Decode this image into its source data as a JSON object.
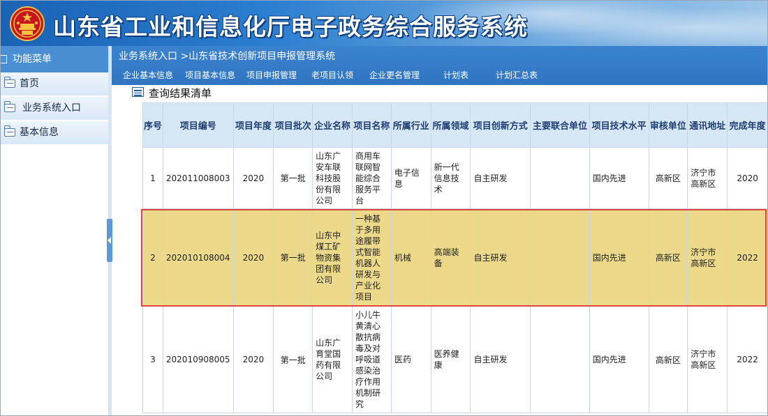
{
  "header": {
    "title": "山东省工业和信息化厅电子政务综合服务系统"
  },
  "sidebar": {
    "menu_title": "功能菜单",
    "items": [
      {
        "label": "首页"
      },
      {
        "label": "业务系统入口"
      },
      {
        "label": "基本信息"
      }
    ]
  },
  "main": {
    "breadcrumb": "业务系统入口 >山东省技术创新项目申报管理系统",
    "tabs": [
      {
        "label": "企业基本信息"
      },
      {
        "label": "项目基本信息"
      },
      {
        "label": "项目申报管理"
      },
      {
        "label": "老项目认领"
      },
      {
        "label": "企业更名管理"
      },
      {
        "label": "计划表"
      },
      {
        "label": "计划汇总表"
      }
    ],
    "result_title": "查询结果清单"
  },
  "table": {
    "columns": [
      "序号",
      "项目编号",
      "项目年度",
      "项目批次",
      "企业名称",
      "项目名称",
      "所属行业",
      "所属领域",
      "项目创新方式",
      "主要联合单位",
      "项目技术水平",
      "审核单位",
      "通讯地址",
      "完成年度"
    ],
    "rows": [
      {
        "seq": "1",
        "code": "202011008003",
        "year": "2020",
        "batch": "第一批",
        "company": "山东广安车联科技股份有限公司",
        "project": "商用车联网智能综合服务平台",
        "industry": "电子信息",
        "field": "新一代信息技术",
        "innovation": "自主研发",
        "partner": "",
        "level": "国内先进",
        "auditor": "高新区",
        "address": "济宁市高新区",
        "finish_year": "2020",
        "selected": false
      },
      {
        "seq": "2",
        "code": "202010108004",
        "year": "2020",
        "batch": "第一批",
        "company": "山东中煤工矿物资集团有限公司",
        "project": "一种基于多用途履带式智能机器人研发与产业化项目",
        "industry": "机械",
        "field": "高端装备",
        "innovation": "自主研发",
        "partner": "",
        "level": "国内先进",
        "auditor": "高新区",
        "address": "济宁市高新区",
        "finish_year": "2022",
        "selected": true
      },
      {
        "seq": "3",
        "code": "202010908005",
        "year": "2020",
        "batch": "第一批",
        "company": "山东广育堂国药有限公司",
        "project": "小儿牛黄清心散抗病毒及对呼吸道感染治疗作用机制研究",
        "industry": "医药",
        "field": "医养健康",
        "innovation": "自主研发",
        "partner": "",
        "level": "国内先进",
        "auditor": "高新区",
        "address": "济宁市高新区",
        "finish_year": "2022",
        "selected": false
      }
    ]
  },
  "colors": {
    "header_blue": "#1a62b4",
    "bar_blue": "#2f75c2",
    "menu_head": "#4a8fd4",
    "table_header": "#d7e7f5",
    "selected_row": "#ecda8a",
    "selection_border": "#e0443c"
  }
}
